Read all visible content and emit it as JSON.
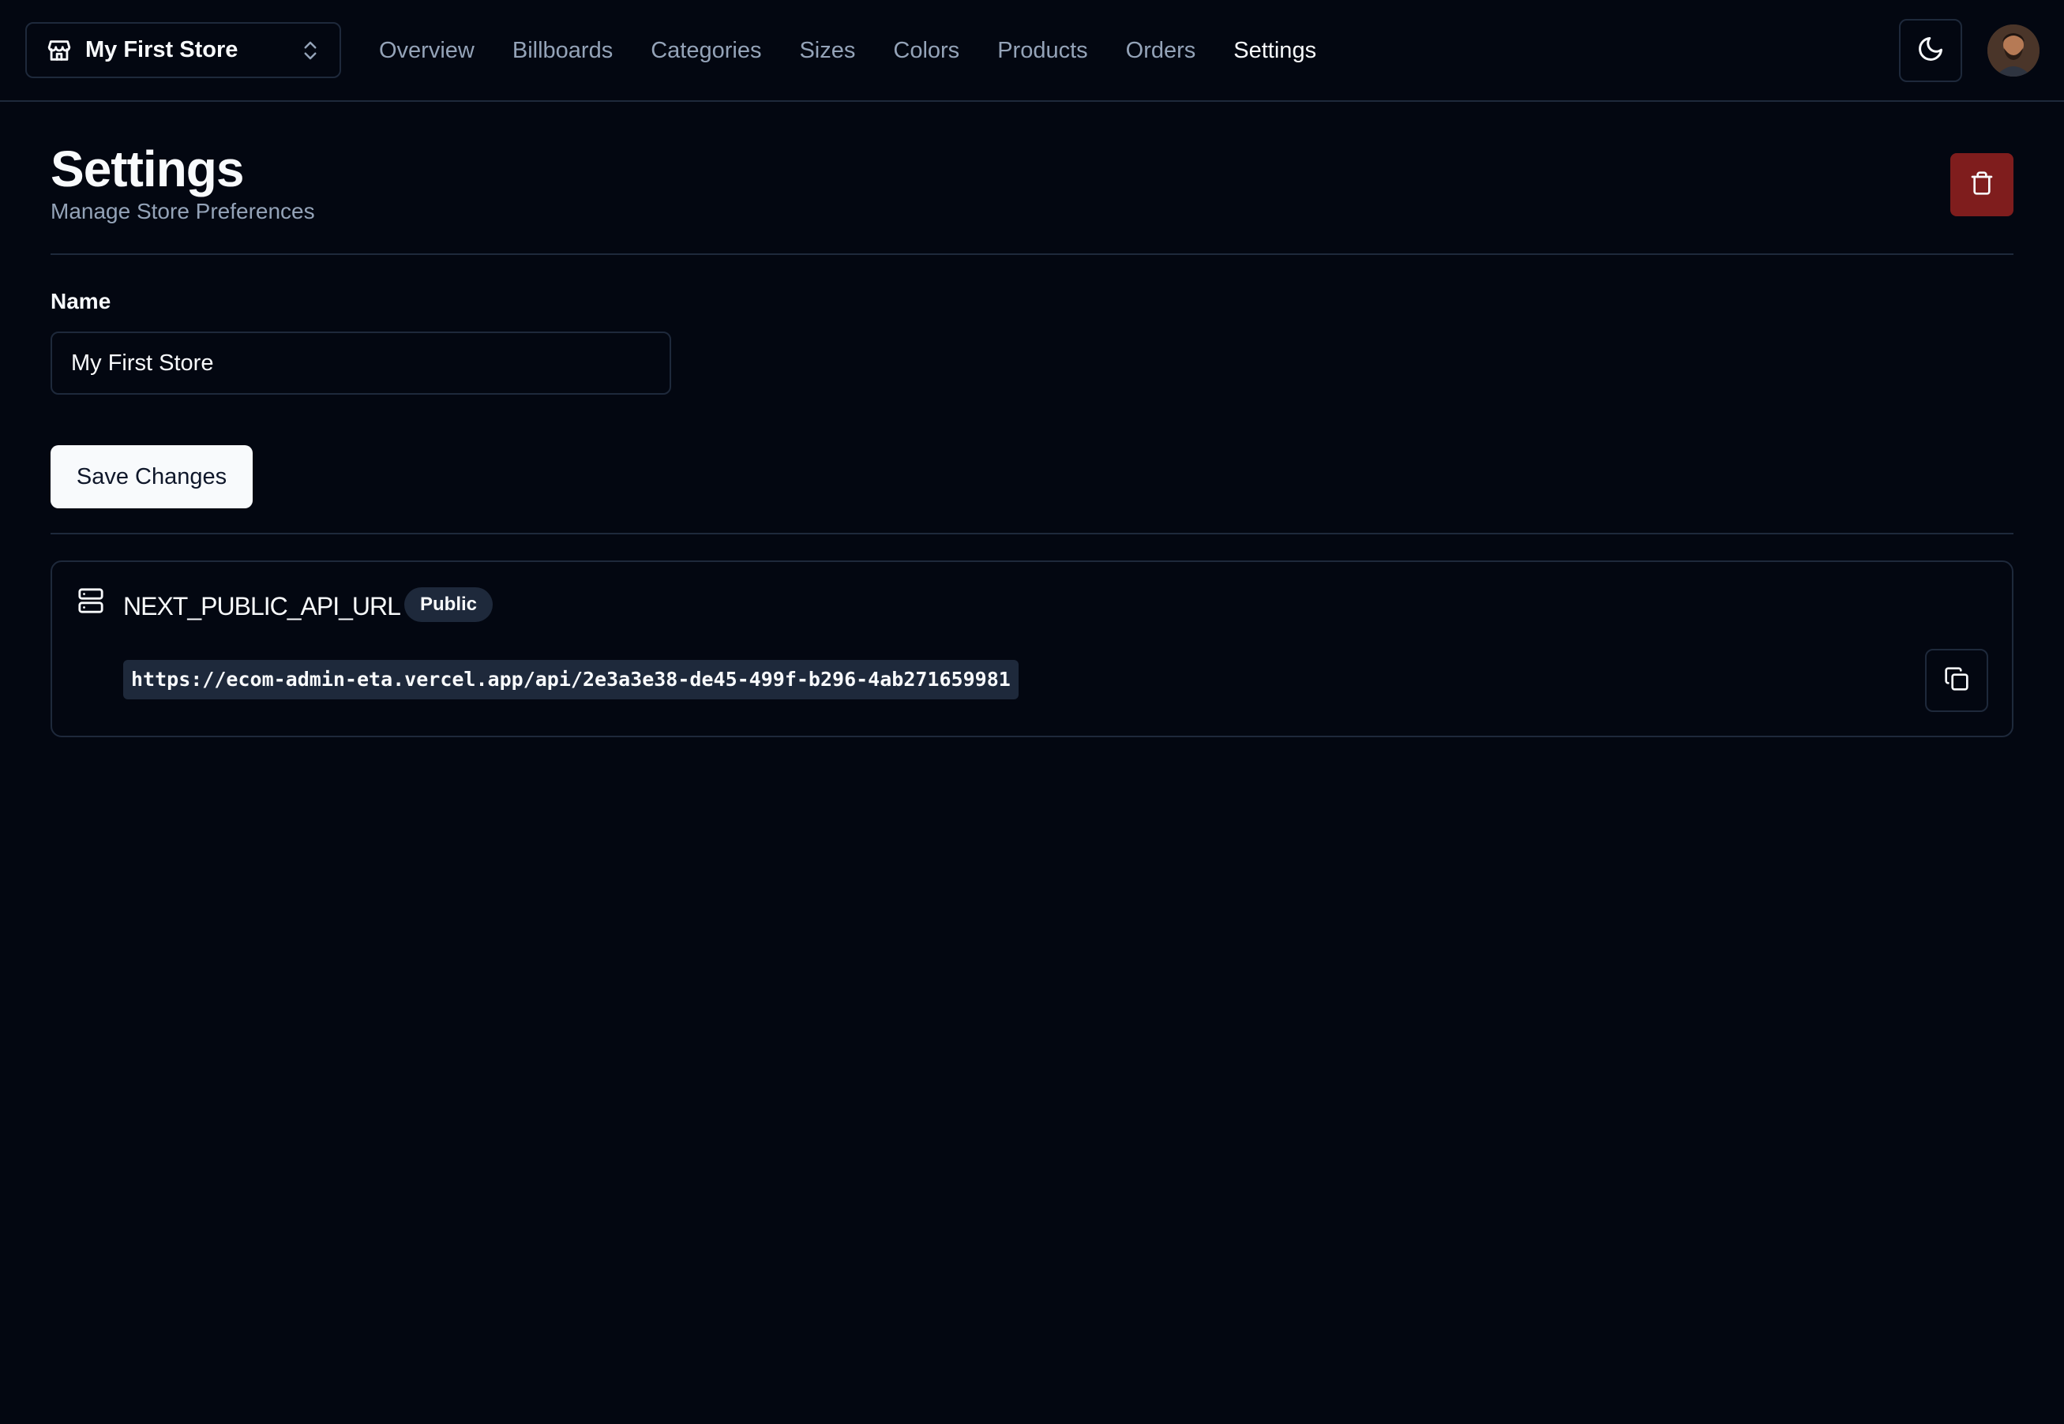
{
  "store_switcher": {
    "store_name": "My First Store",
    "icon": "store-icon",
    "chevron_icon": "chevrons-up-down-icon"
  },
  "nav": {
    "items": [
      {
        "label": "Overview",
        "active": false
      },
      {
        "label": "Billboards",
        "active": false
      },
      {
        "label": "Categories",
        "active": false
      },
      {
        "label": "Sizes",
        "active": false
      },
      {
        "label": "Colors",
        "active": false
      },
      {
        "label": "Products",
        "active": false
      },
      {
        "label": "Orders",
        "active": false
      },
      {
        "label": "Settings",
        "active": true
      }
    ]
  },
  "header_actions": {
    "theme_icon": "moon-icon",
    "avatar": "user-avatar"
  },
  "page": {
    "title": "Settings",
    "subtitle": "Manage Store Preferences",
    "delete_icon": "trash-icon"
  },
  "form": {
    "name_label": "Name",
    "name_value": "My First Store",
    "save_label": "Save Changes"
  },
  "api_alert": {
    "icon": "server-icon",
    "title": "NEXT_PUBLIC_API_URL",
    "badge": "Public",
    "url": "https://ecom-admin-eta.vercel.app/api/2e3a3e38-de45-499f-b296-4ab271659981",
    "copy_icon": "copy-icon"
  },
  "colors": {
    "background": "#030711",
    "border": "#1e293b",
    "muted_text": "#94a3b8",
    "foreground": "#f8fafc",
    "destructive": "#7f1d1d"
  }
}
